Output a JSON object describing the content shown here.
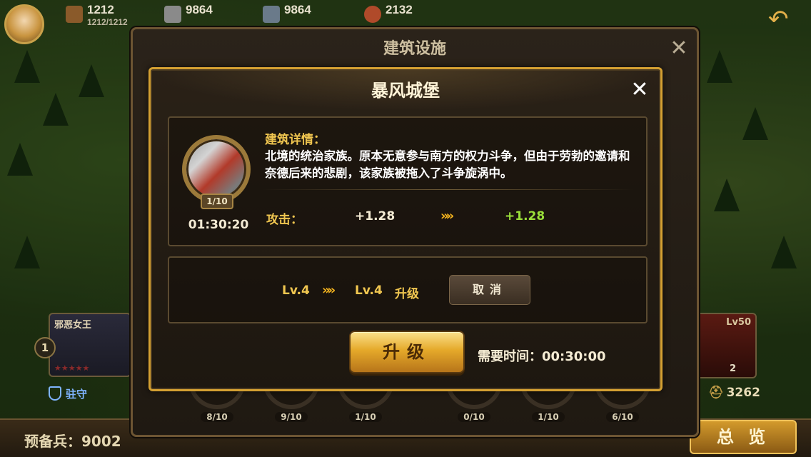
{
  "resources": [
    {
      "icon": "wood-icon",
      "value": "1212",
      "sub": "1212/1212",
      "color": "#8a5a2a"
    },
    {
      "icon": "stone-icon",
      "value": "9864",
      "sub": "",
      "color": "#8a8a8a"
    },
    {
      "icon": "iron-icon",
      "value": "9864",
      "sub": "",
      "color": "#6a7a8a"
    },
    {
      "icon": "meat-icon",
      "value": "2132",
      "sub": "",
      "color": "#b04a2a"
    }
  ],
  "hero_left": {
    "name": "邪恶女王",
    "number": "1",
    "stars": "★★★★★",
    "guard_label": "驻守"
  },
  "hero_right": {
    "level": "Lv50",
    "count": "2",
    "power": "3262"
  },
  "bottom": {
    "reserve_label": "预备兵：9002",
    "overview": "总 览"
  },
  "outer_panel": {
    "title": "建筑设施",
    "slots": [
      "8/10",
      "9/10",
      "1/10",
      "0/10",
      "1/10",
      "6/10"
    ]
  },
  "dialog": {
    "title": "暴风城堡",
    "building_level": "1/10",
    "timer": "01:30:20",
    "detail_title": "建筑详情：",
    "detail_text": "北境的统治家族。原本无意参与南方的权力斗争，但由于劳勃的邀请和奈德后来的悲剧，该家族被拖入了斗争旋涡中。",
    "attack_label": "攻击：",
    "attack_current": "+1.28",
    "attack_next": "+1.28",
    "arrows": "»»",
    "level_from": "Lv.4",
    "level_to": "Lv.4",
    "level_action": "升级",
    "cancel_label": "取消",
    "upgrade_label": "升级",
    "need_time": "需要时间：00:30:00"
  },
  "colors": {
    "gold_border": "#d4a032",
    "label_gold": "#f0c650",
    "green": "#9adf3a"
  }
}
